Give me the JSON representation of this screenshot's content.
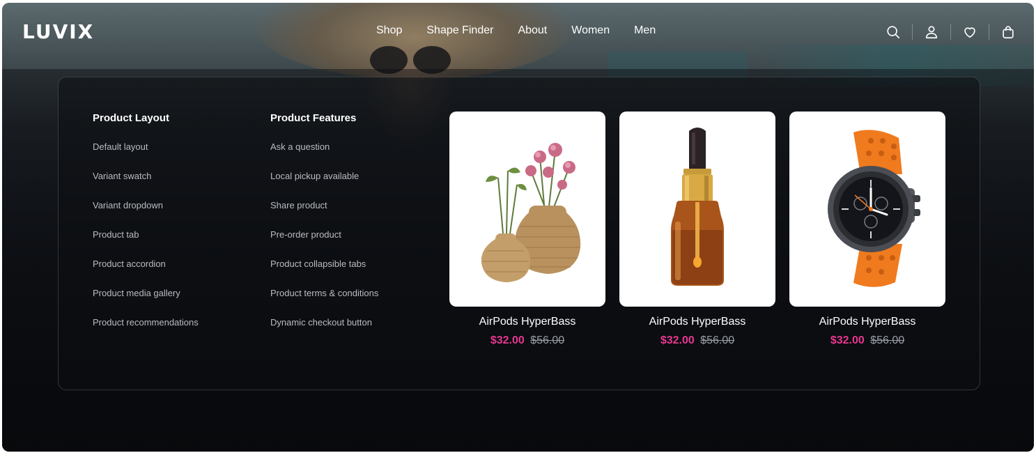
{
  "brand": {
    "logo": "LUVIX"
  },
  "nav": {
    "items": [
      "Shop",
      "Shape Finder",
      "About",
      "Women",
      "Men"
    ]
  },
  "header_icons": [
    "search-icon",
    "user-icon",
    "heart-icon",
    "bag-icon"
  ],
  "menu": {
    "columns": [
      {
        "title": "Product Layout",
        "links": [
          "Default layout",
          "Variant swatch",
          "Variant dropdown",
          "Product tab",
          "Product accordion",
          "Product media gallery",
          "Product recommendations"
        ]
      },
      {
        "title": "Product Features",
        "links": [
          "Ask a question",
          "Local pickup available",
          "Share product",
          "Pre-order product",
          "Product collapsible tabs",
          "Product terms & conditions",
          "Dynamic checkout button"
        ]
      }
    ],
    "products": [
      {
        "name": "AirPods HyperBass",
        "price": "$32.00",
        "old_price": "$56.00",
        "image": "woven-vases-with-flowers"
      },
      {
        "name": "AirPods HyperBass",
        "price": "$32.00",
        "old_price": "$56.00",
        "image": "amber-dropper-bottle"
      },
      {
        "name": "AirPods HyperBass",
        "price": "$32.00",
        "old_price": "$56.00",
        "image": "orange-smartwatch"
      }
    ]
  },
  "colors": {
    "sale_price": "#e8368f",
    "old_price": "#9a9ea6",
    "panel_border": "#3a3d43"
  }
}
